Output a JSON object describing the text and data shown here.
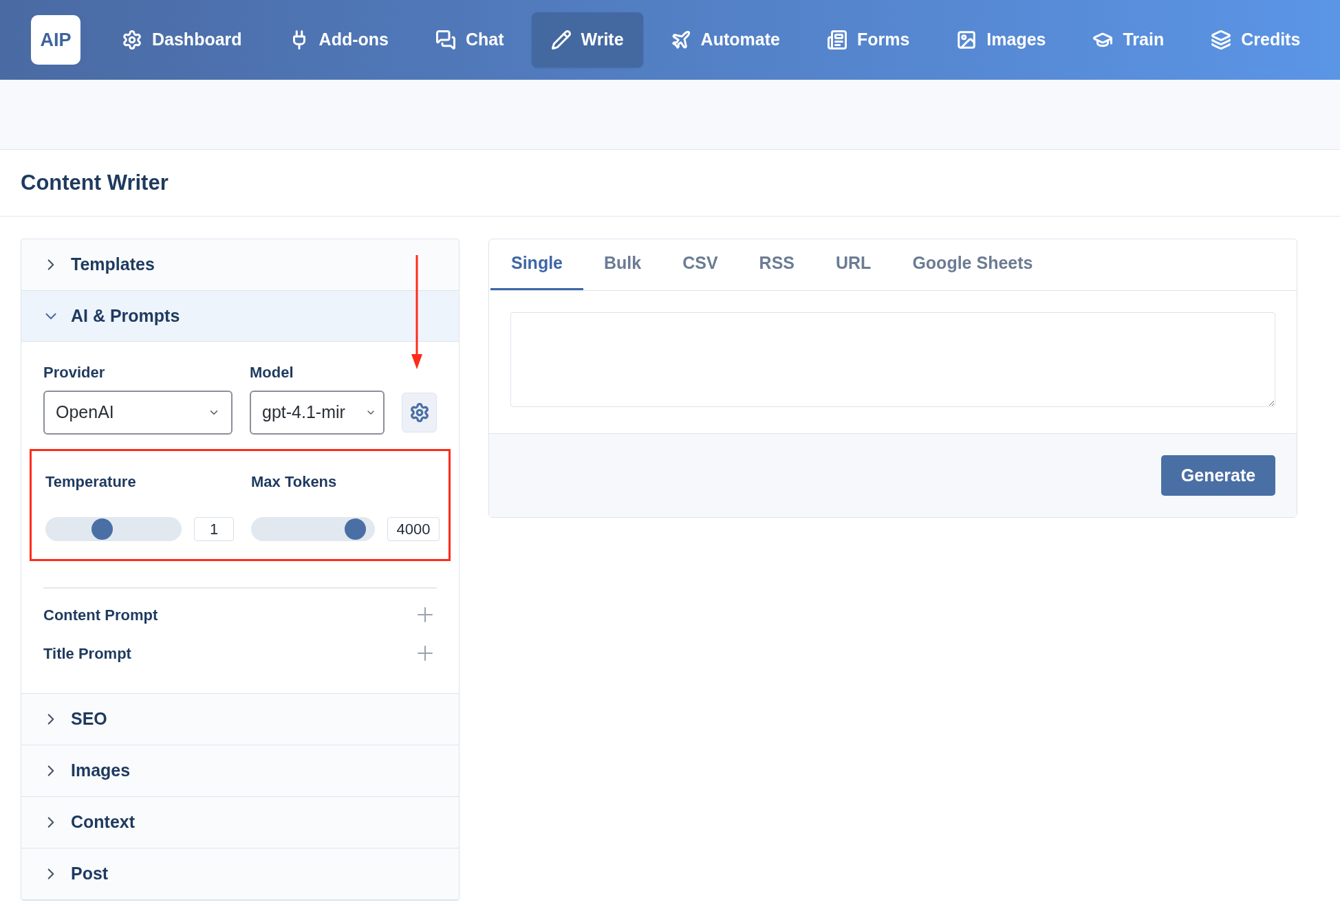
{
  "nav": {
    "logo": "AIP",
    "items": [
      {
        "label": "Dashboard",
        "selected": false
      },
      {
        "label": "Add-ons",
        "selected": false
      },
      {
        "label": "Chat",
        "selected": false
      },
      {
        "label": "Write",
        "selected": true
      },
      {
        "label": "Automate",
        "selected": false
      },
      {
        "label": "Forms",
        "selected": false
      },
      {
        "label": "Images",
        "selected": false
      },
      {
        "label": "Train",
        "selected": false
      },
      {
        "label": "Credits",
        "selected": false
      }
    ]
  },
  "page_title": "Content Writer",
  "sections": [
    {
      "title": "Templates",
      "expanded": false
    },
    {
      "title": "AI & Prompts",
      "expanded": true,
      "content": {
        "provider": {
          "label": "Provider",
          "value": "OpenAI"
        },
        "model": {
          "label": "Model",
          "value": "gpt-4.1-mir"
        },
        "temperature": {
          "label": "Temperature",
          "level": 0.4,
          "value": "1"
        },
        "max_tokens": {
          "label": "Max Tokens",
          "level": 0.91,
          "value": "4000"
        },
        "prompts": [
          {
            "label": "Content Prompt"
          },
          {
            "label": "Title Prompt"
          }
        ]
      }
    },
    {
      "title": "SEO",
      "expanded": false
    },
    {
      "title": "Images",
      "expanded": false
    },
    {
      "title": "Context",
      "expanded": false
    },
    {
      "title": "Post",
      "expanded": false
    }
  ],
  "tabs": [
    {
      "label": "Single",
      "selected": true
    },
    {
      "label": "Bulk",
      "selected": false
    },
    {
      "label": "CSV",
      "selected": false
    },
    {
      "label": "RSS",
      "selected": false
    },
    {
      "label": "URL",
      "selected": false
    },
    {
      "label": "Google Sheets",
      "selected": false
    }
  ],
  "generate_button": "Generate"
}
